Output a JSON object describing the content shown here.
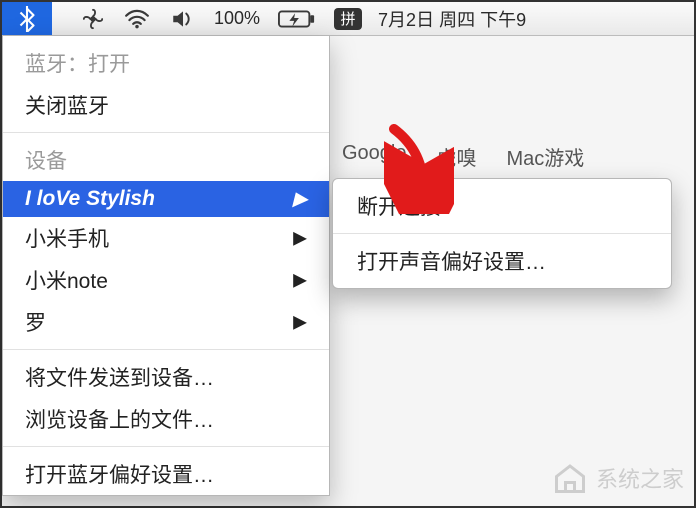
{
  "menubar": {
    "battery_percent": "100%",
    "ime_label": "拼",
    "clock": "7月2日 周四 下午9"
  },
  "bt_menu": {
    "status_label": "蓝牙：打开",
    "turn_off_label": "关闭蓝牙",
    "devices_header": "设备",
    "devices": [
      {
        "name": "I loVe Stylish",
        "selected": true
      },
      {
        "name": "小米手机",
        "selected": false
      },
      {
        "name": "小米note",
        "selected": false
      },
      {
        "name": "罗",
        "selected": false
      }
    ],
    "send_file_label": "将文件发送到设备…",
    "browse_files_label": "浏览设备上的文件…",
    "prefs_label": "打开蓝牙偏好设置…"
  },
  "submenu": {
    "disconnect_label": "断开连接",
    "sound_prefs_label": "打开声音偏好设置…"
  },
  "bookmarks": {
    "a": "Google",
    "b": "虎嗅",
    "c": "Mac游戏"
  },
  "watermark": {
    "text": "系统之家"
  },
  "colors": {
    "menubar_highlight": "#1f67e0",
    "menu_selection": "#2a63e3",
    "annotation_arrow": "#e11b1b"
  }
}
